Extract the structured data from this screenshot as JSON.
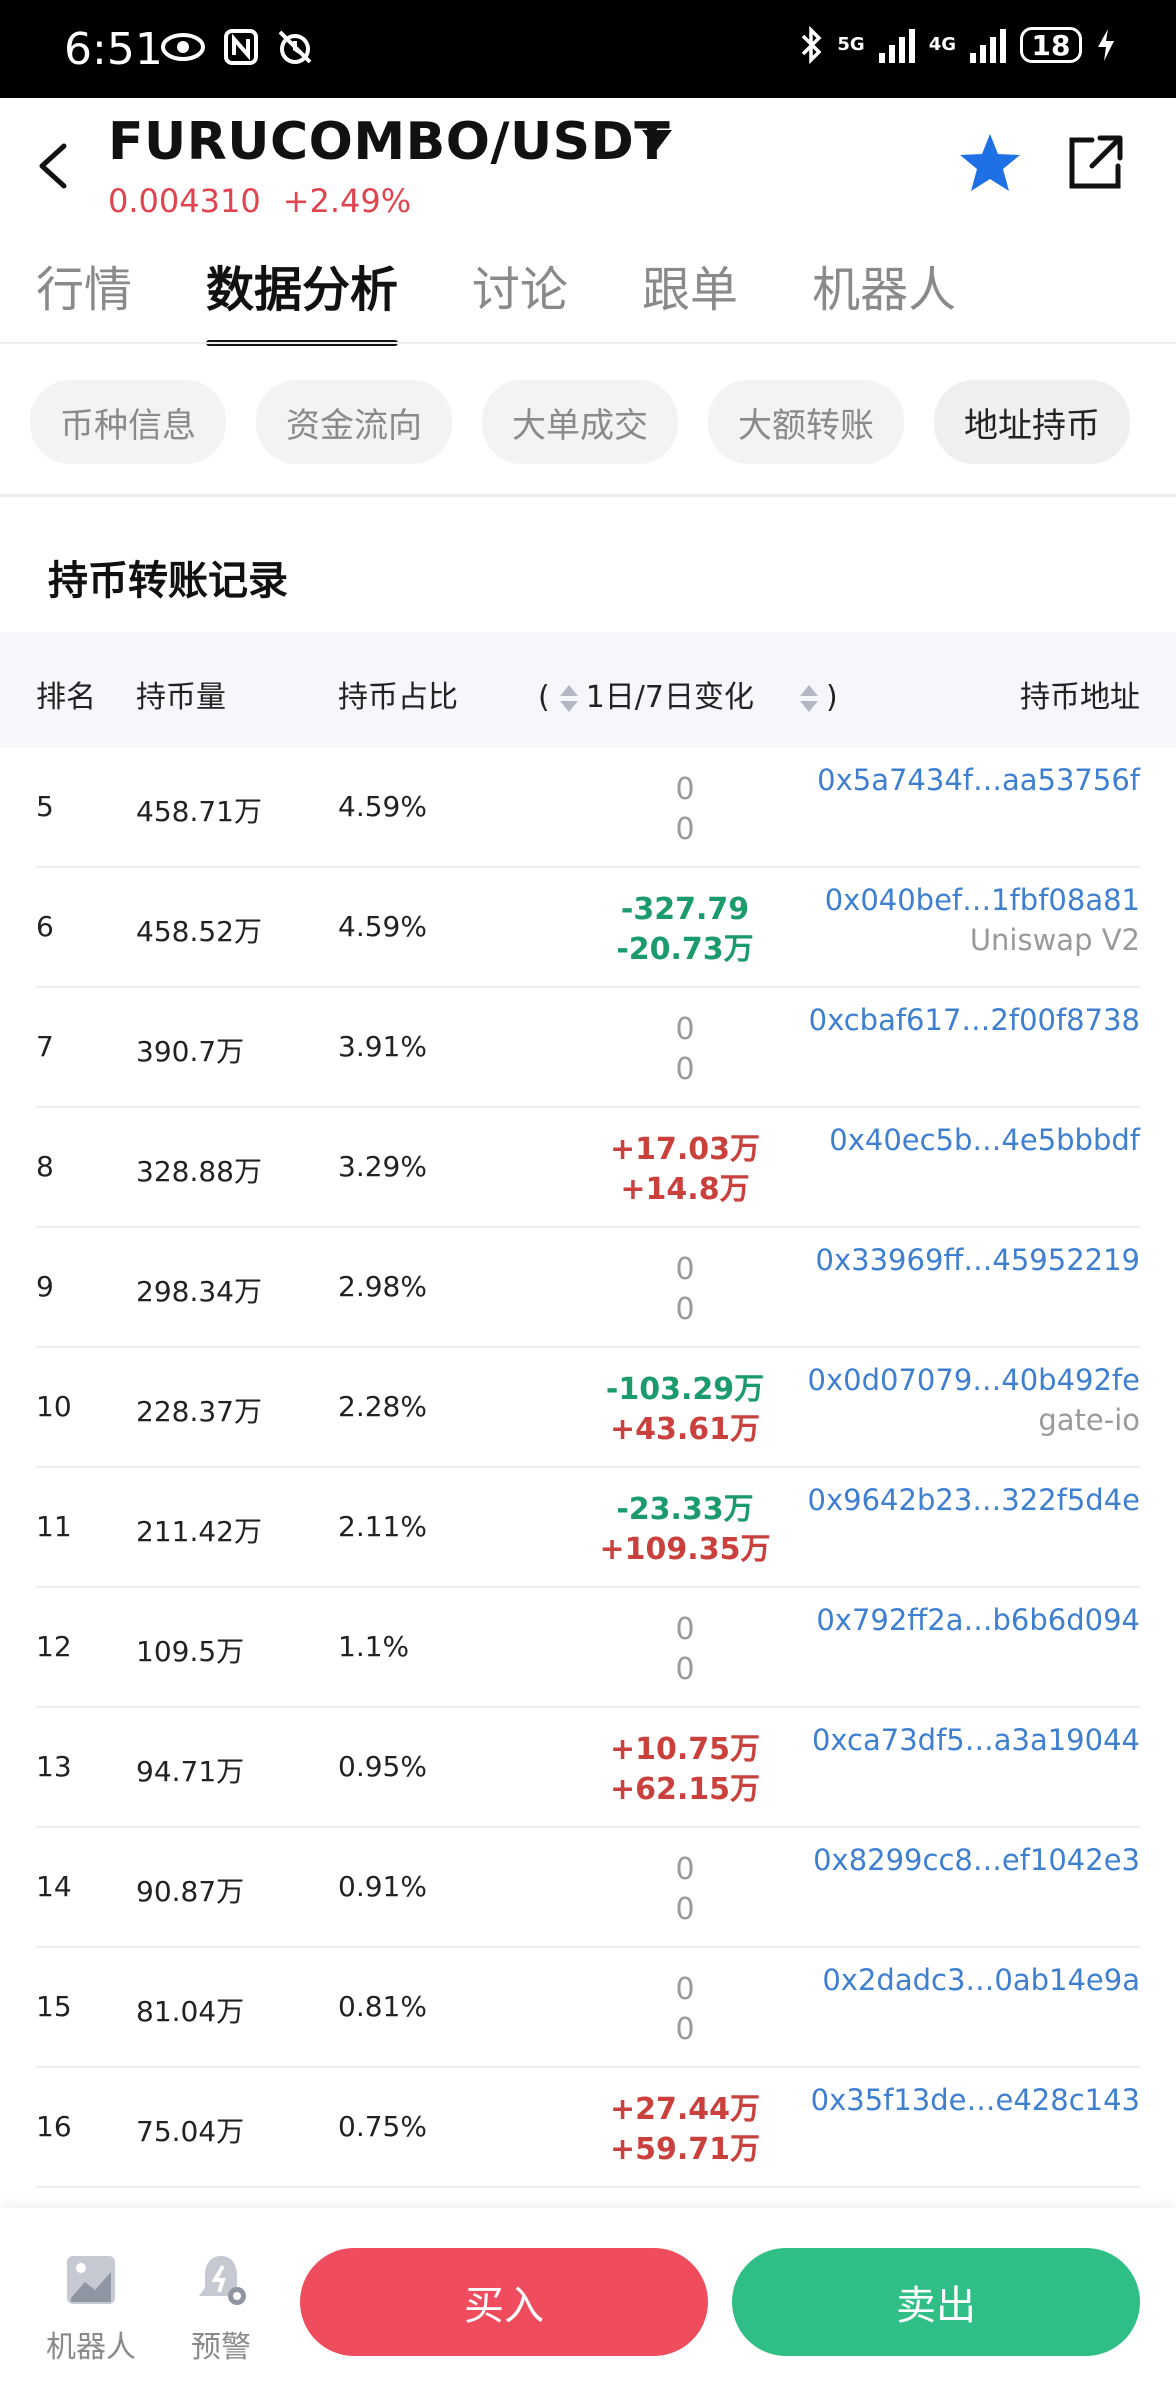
{
  "status_bar": {
    "time": "6:51",
    "network_top": "5G",
    "network_4g": "4G",
    "battery": "18"
  },
  "header": {
    "title": "FURUCOMBO/USDT",
    "price": "0.004310",
    "change": "+2.49%"
  },
  "main_tabs": [
    {
      "label": "行情",
      "active": false
    },
    {
      "label": "数据分析",
      "active": true
    },
    {
      "label": "讨论",
      "active": false
    },
    {
      "label": "跟单",
      "active": false
    },
    {
      "label": "机器人",
      "active": false
    }
  ],
  "sub_tabs": [
    {
      "label": "币种信息",
      "active": false
    },
    {
      "label": "资金流向",
      "active": false
    },
    {
      "label": "大单成交",
      "active": false
    },
    {
      "label": "大额转账",
      "active": false
    },
    {
      "label": "地址持币",
      "active": true
    }
  ],
  "section_title": "持币转账记录",
  "table": {
    "headers": {
      "rank": "排名",
      "amount": "持币量",
      "ratio": "持币占比",
      "change_open": "(",
      "change": "1日/7日变化",
      "change_close": ")",
      "address": "持币地址"
    },
    "rows": [
      {
        "rank": "5",
        "amount": "458.71万",
        "ratio": "4.59%",
        "d1": "0",
        "d7": "0",
        "address": "0x5a7434f…aa53756f",
        "tag": ""
      },
      {
        "rank": "6",
        "amount": "458.52万",
        "ratio": "4.59%",
        "d1": "-327.79",
        "d7": "-20.73万",
        "address": "0x040bef…1fbf08a81",
        "tag": "Uniswap V2"
      },
      {
        "rank": "7",
        "amount": "390.7万",
        "ratio": "3.91%",
        "d1": "0",
        "d7": "0",
        "address": "0xcbaf617…2f00f8738",
        "tag": ""
      },
      {
        "rank": "8",
        "amount": "328.88万",
        "ratio": "3.29%",
        "d1": "+17.03万",
        "d7": "+14.8万",
        "address": "0x40ec5b…4e5bbbdf",
        "tag": ""
      },
      {
        "rank": "9",
        "amount": "298.34万",
        "ratio": "2.98%",
        "d1": "0",
        "d7": "0",
        "address": "0x33969ff…45952219",
        "tag": ""
      },
      {
        "rank": "10",
        "amount": "228.37万",
        "ratio": "2.28%",
        "d1": "-103.29万",
        "d7": "+43.61万",
        "address": "0x0d07079…40b492fe",
        "tag": "gate-io"
      },
      {
        "rank": "11",
        "amount": "211.42万",
        "ratio": "2.11%",
        "d1": "-23.33万",
        "d7": "+109.35万",
        "address": "0x9642b23…322f5d4e",
        "tag": ""
      },
      {
        "rank": "12",
        "amount": "109.5万",
        "ratio": "1.1%",
        "d1": "0",
        "d7": "0",
        "address": "0x792ff2a…b6b6d094",
        "tag": ""
      },
      {
        "rank": "13",
        "amount": "94.71万",
        "ratio": "0.95%",
        "d1": "+10.75万",
        "d7": "+62.15万",
        "address": "0xca73df5…a3a19044",
        "tag": ""
      },
      {
        "rank": "14",
        "amount": "90.87万",
        "ratio": "0.91%",
        "d1": "0",
        "d7": "0",
        "address": "0x8299cc8…ef1042e3",
        "tag": ""
      },
      {
        "rank": "15",
        "amount": "81.04万",
        "ratio": "0.81%",
        "d1": "0",
        "d7": "0",
        "address": "0x2dadc3…0ab14e9a",
        "tag": ""
      },
      {
        "rank": "16",
        "amount": "75.04万",
        "ratio": "0.75%",
        "d1": "+27.44万",
        "d7": "+59.71万",
        "address": "0x35f13de…e428c143",
        "tag": ""
      }
    ]
  },
  "bottom": {
    "robot_label": "机器人",
    "alert_label": "预警",
    "buy_label": "买入",
    "sell_label": "卖出"
  },
  "colors": {
    "up": "#c9403d",
    "down": "#1b9a6b",
    "link": "#3f7fd0",
    "buy": "#ef4d5e",
    "sell": "#2fbf86",
    "star": "#1f6fe5"
  }
}
